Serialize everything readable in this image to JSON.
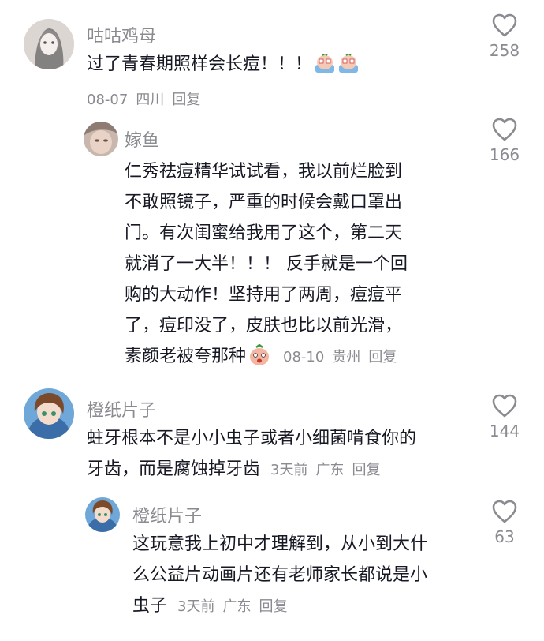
{
  "comments": [
    {
      "username": "咕咕鸡母",
      "text": "过了青春期照样会长痘！！！",
      "date": "08-07",
      "location": "四川",
      "reply_label": "回复",
      "likes": "258"
    },
    {
      "username": "嫁鱼",
      "lines": [
        "仁秀祛痘精华试试看，我以前烂脸到",
        "不敢照镜子，严重的时候会戴口罩出",
        "门。有次闺蜜给我用了这个，第二天",
        "就消了一大半！！！ 反手就是一个回",
        "购的大动作！坚持用了两周，痘痘平",
        "了，痘印没了，皮肤也比以前光滑，",
        "素颜老被夸那种"
      ],
      "date": "08-10",
      "location": "贵州",
      "reply_label": "回复",
      "likes": "166"
    },
    {
      "username": "橙纸片子",
      "lines": [
        "蛀牙根本不是小小虫子或者小细菌啃食你的",
        "牙齿，而是腐蚀掉牙齿"
      ],
      "date": "3天前",
      "location": "广东",
      "reply_label": "回复",
      "likes": "144"
    },
    {
      "username": "橙纸片子",
      "lines": [
        "这玩意我上初中才理解到，从小到大什",
        "么公益片动画片还有老师家长都说是小",
        "虫子"
      ],
      "date": "3天前",
      "location": "广东",
      "reply_label": "回复",
      "likes": "63"
    }
  ],
  "icons": {
    "like": "heart-outline-icon",
    "emoji": "crying-face-sticker"
  }
}
